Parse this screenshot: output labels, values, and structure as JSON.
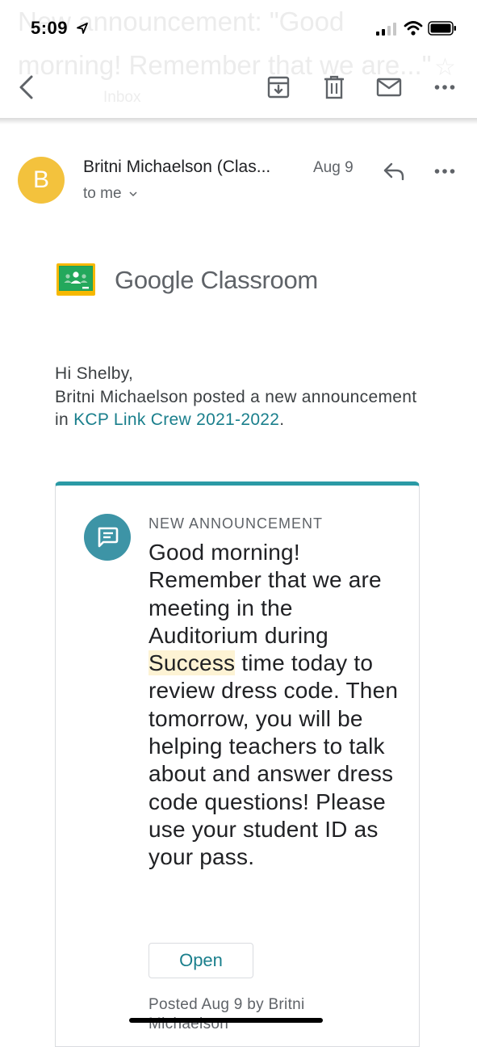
{
  "status_bar": {
    "time": "5:09"
  },
  "subject": {
    "text": "New announcement: \"Good morning! Remember that we are...\"",
    "label": "Inbox"
  },
  "toolbar": {
    "icons": [
      "back-icon",
      "archive-icon",
      "trash-icon",
      "mail-icon",
      "more-icon"
    ]
  },
  "message": {
    "avatar_letter": "B",
    "avatar_color": "#f3c23d",
    "sender": "Britni Michaelson (Clas...",
    "date": "Aug 9",
    "recipient": "to me"
  },
  "classroom": {
    "brand": "Google",
    "product": "Classroom"
  },
  "greeting": {
    "line1": "Hi Shelby,",
    "line2": "Britni Michaelson posted a new announcement in ",
    "class_link": "KCP Link Crew 2021-2022",
    "end": "."
  },
  "announcement": {
    "label": "NEW ANNOUNCEMENT",
    "body_before": "Good morning! Remember that we are meeting in the Auditorium during ",
    "body_highlight": "Success",
    "body_after": " time today to review dress code. Then tomorrow, you will be helping teachers to talk about and answer dress code questions! Please use your student ID as your pass.",
    "open_button": "Open",
    "posted": "Posted Aug 9 by Britni Michaelson"
  },
  "colors": {
    "accent": "#2a9aa5",
    "link": "#1a7f8c",
    "icon_bg": "#3d94a6",
    "highlight": "#fdf3d4"
  }
}
